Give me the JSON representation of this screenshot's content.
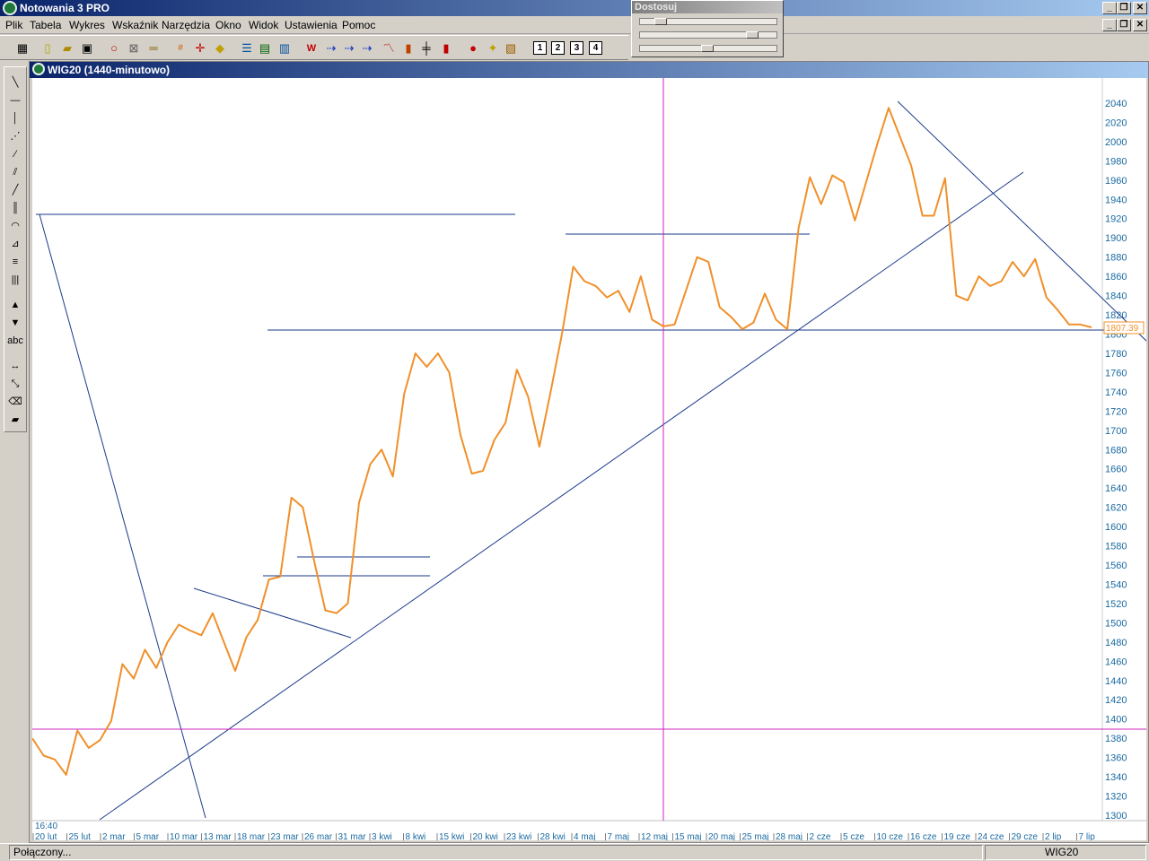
{
  "app": {
    "title": "Notowania 3 PRO"
  },
  "menu": [
    "Plik",
    "Tabela",
    "Wykres",
    "Wskaźnik",
    "Narzędzia",
    "Okno",
    "Widok",
    "Ustawienia",
    "Pomoc"
  ],
  "panel": {
    "title": "Dostosuj"
  },
  "toolbar": {
    "icons": [
      "grid-icon",
      "new-file-icon",
      "open-folder-icon",
      "save-icon",
      "magnify-icon",
      "crosshair-icon",
      "ruler-icon",
      "numbers-icon",
      "cursor-icon",
      "point-icon",
      "list-icon",
      "colors-icon",
      "table-icon",
      "wl-icon",
      "arrow-icon",
      "arrow-icon",
      "arrow-icon",
      "line-chart-icon",
      "bar-chart-icon",
      "ohlc-icon",
      "candle-icon",
      "signal-icon",
      "alert-icon",
      "find-icon"
    ],
    "layout_buttons": [
      "1",
      "2",
      "3",
      "4"
    ]
  },
  "lefttools": {
    "icons": [
      "diagonal-line-icon",
      "horizontal-line-icon",
      "vertical-line-icon",
      "parallel-lines-icon",
      "dashed-lines-icon",
      "fan-lines-icon",
      "slash-icon",
      "vertical-bars-icon",
      "arcs-icon",
      "gann-fan-icon",
      "fibonacci-icon",
      "time-zones-icon",
      "arrow-up-icon",
      "arrow-down-icon",
      "text-tool-icon",
      "horizontal-arrow-icon",
      "resize-icon",
      "eraser-icon",
      "eraser-all-icon"
    ],
    "text_label": "abc"
  },
  "chart_window": {
    "title": "WIG20 (1440-minutowo)",
    "time_label": "16:40",
    "price_label": "1807.39"
  },
  "status": {
    "connection": "Połączony...",
    "symbol": "WIG20"
  },
  "colors": {
    "price_line": "#f0902a",
    "trend_line": "#1a3a8a",
    "crosshair": "#d020c0",
    "axis_text": "#1a6aa0"
  },
  "chart_data": {
    "type": "line",
    "ylim": [
      1290,
      2050
    ],
    "yticks": [
      1300,
      1320,
      1340,
      1360,
      1380,
      1400,
      1420,
      1440,
      1460,
      1480,
      1500,
      1520,
      1540,
      1560,
      1580,
      1600,
      1620,
      1640,
      1660,
      1680,
      1700,
      1720,
      1740,
      1760,
      1780,
      1800,
      1820,
      1840,
      1860,
      1880,
      1900,
      1920,
      1940,
      1960,
      1980,
      2000,
      2020,
      2040
    ],
    "xticks": [
      "20 lut",
      "25 lut",
      "2 mar",
      "5 mar",
      "10 mar",
      "13 mar",
      "18 mar",
      "23 mar",
      "26 mar",
      "31 mar",
      "3 kwi",
      "8 kwi",
      "15 kwi",
      "20 kwi",
      "23 kwi",
      "28 kwi",
      "4 maj",
      "7 maj",
      "12 maj",
      "15 maj",
      "20 maj",
      "25 maj",
      "28 maj",
      "2 cze",
      "5 cze",
      "10 cze",
      "16 cze",
      "19 cze",
      "24 cze",
      "29 cze",
      "2 lip",
      "7 lip"
    ],
    "series": [
      {
        "values": [
          1380,
          1362,
          1358,
          1342,
          1388,
          1370,
          1378,
          1398,
          1457,
          1442,
          1472,
          1453,
          1480,
          1498,
          1492,
          1487,
          1510,
          1480,
          1450,
          1485,
          1503,
          1545,
          1548,
          1630,
          1620,
          1565,
          1513,
          1510,
          1520,
          1625,
          1665,
          1680,
          1652,
          1738,
          1780,
          1766,
          1780,
          1760,
          1695,
          1655,
          1658,
          1690,
          1708,
          1763,
          1735,
          1683,
          1740,
          1800,
          1870,
          1855,
          1850,
          1838,
          1845,
          1823,
          1860,
          1815,
          1808,
          1810,
          1845,
          1880,
          1875,
          1828,
          1818,
          1805,
          1812,
          1842,
          1815,
          1805,
          1910,
          1963,
          1935,
          1965,
          1958,
          1918,
          1958,
          1998,
          2035,
          2005,
          1975,
          1923,
          1923,
          1962,
          1840,
          1835,
          1860,
          1850,
          1855,
          1875,
          1860,
          1878,
          1838,
          1825,
          1810,
          1810,
          1807
        ]
      }
    ]
  }
}
